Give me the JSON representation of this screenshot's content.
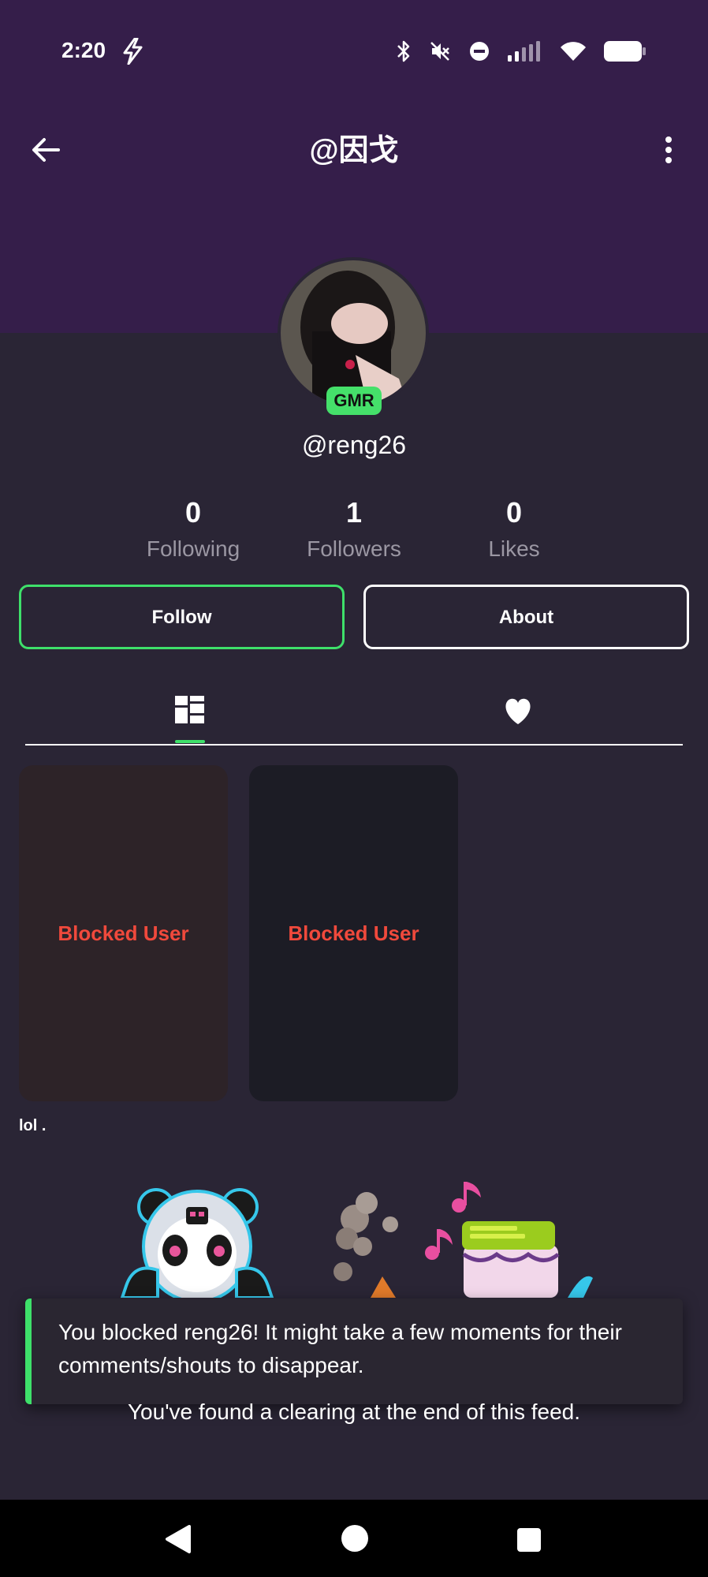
{
  "status_bar": {
    "time": "2:20",
    "icons": [
      "bolt-icon",
      "bluetooth-icon",
      "mute-icon",
      "dnd-icon",
      "signal-icon",
      "wifi-icon",
      "battery-icon"
    ]
  },
  "app_bar": {
    "title": "@因戈",
    "icons": [
      "back-arrow-icon",
      "more-vert-icon"
    ]
  },
  "profile": {
    "badge": "GMR",
    "username": "@reng26"
  },
  "stats": [
    {
      "value": "0",
      "label": "Following"
    },
    {
      "value": "1",
      "label": "Followers"
    },
    {
      "value": "0",
      "label": "Likes"
    }
  ],
  "buttons": {
    "follow": "Follow",
    "about": "About"
  },
  "tabs": [
    "grid-icon",
    "heart-icon"
  ],
  "cards": [
    {
      "label": "Blocked User",
      "color": "#2d2328"
    },
    {
      "label": "Blocked User",
      "color": "#1c1c25"
    }
  ],
  "caption": "lol .",
  "toast": {
    "message": "You blocked reng26! It might take a few moments for their comments/shouts to disappear."
  },
  "end_message": "You've found a clearing at the end of this feed.",
  "colors": {
    "header": "#351e4a",
    "background": "#2a2535",
    "accent_green": "#3ee06a",
    "blocked_red": "#f0493c"
  },
  "nav_bar": [
    "nav-back-icon",
    "nav-home-icon",
    "nav-recents-icon"
  ]
}
